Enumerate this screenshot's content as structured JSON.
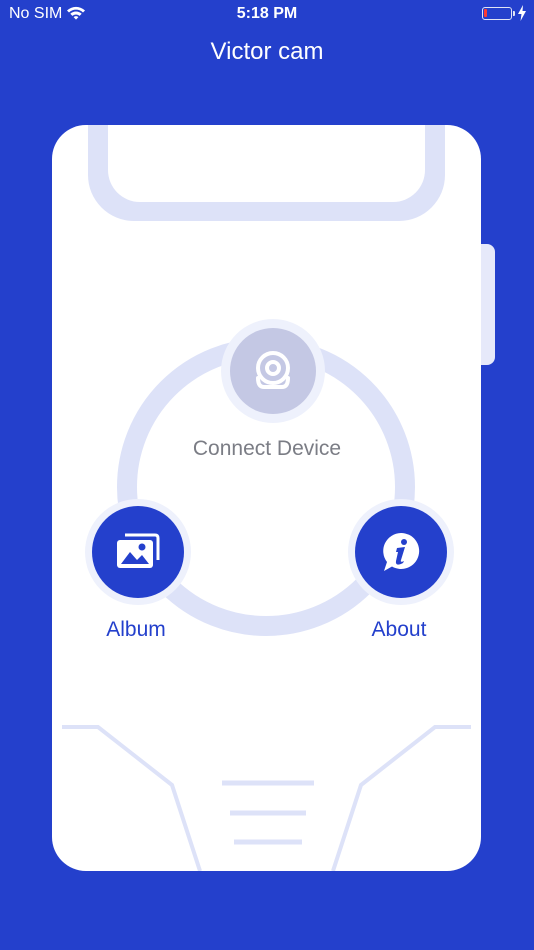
{
  "status_bar": {
    "carrier": "No SIM",
    "time": "5:18 PM"
  },
  "nav": {
    "title": "Victor cam"
  },
  "menu": {
    "connect_label": "Connect Device",
    "album_label": "Album",
    "about_label": "About"
  },
  "icons": [
    "wifi-icon",
    "battery-icon",
    "charging-bolt-icon",
    "camera-icon",
    "picture-icon",
    "info-icon"
  ],
  "colors": {
    "brand_blue": "#2440cc",
    "ring_light": "#dde2f8",
    "connect_gray": "#c4c8e4"
  }
}
